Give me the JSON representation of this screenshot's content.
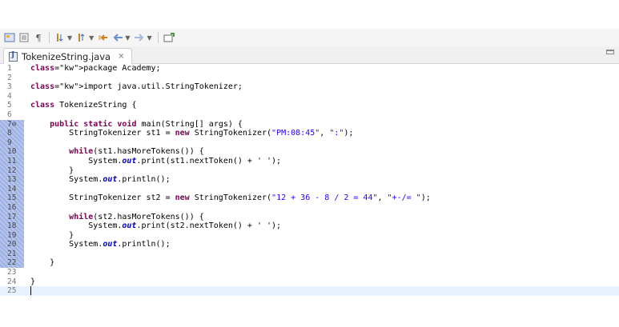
{
  "toolbar": {
    "icons": [
      "open-type-icon",
      "show-whitespace-icon",
      "pilcrow-icon",
      "next-annotation-icon",
      "prev-annotation-icon",
      "last-edit-icon",
      "back-icon",
      "forward-icon",
      "pin-editor-icon"
    ]
  },
  "tab": {
    "title": "TokenizeString.java",
    "close_glyph": "⨯"
  },
  "editor": {
    "lines": [
      {
        "n": "1",
        "code": "package Academy;"
      },
      {
        "n": "2",
        "code": ""
      },
      {
        "n": "3",
        "code": "import java.util.StringTokenizer;"
      },
      {
        "n": "4",
        "code": ""
      },
      {
        "n": "5",
        "code": "class TokenizeString {"
      },
      {
        "n": "6",
        "code": ""
      },
      {
        "n": "7⊖",
        "code": "    public static void main(String[] args) {"
      },
      {
        "n": "8",
        "code": "        StringTokenizer st1 = new StringTokenizer(\"PM:08:45\", \":\");"
      },
      {
        "n": "9",
        "code": ""
      },
      {
        "n": "10",
        "code": "        while(st1.hasMoreTokens()) {"
      },
      {
        "n": "11",
        "code": "            System.out.print(st1.nextToken() + ' ');"
      },
      {
        "n": "12",
        "code": "        }"
      },
      {
        "n": "13",
        "code": "        System.out.println();"
      },
      {
        "n": "14",
        "code": ""
      },
      {
        "n": "15",
        "code": "        StringTokenizer st2 = new StringTokenizer(\"12 + 36 - 8 / 2 = 44\", \"+-/= \");"
      },
      {
        "n": "16",
        "code": ""
      },
      {
        "n": "17",
        "code": "        while(st2.hasMoreTokens()) {"
      },
      {
        "n": "18",
        "code": "            System.out.print(st2.nextToken() + ' ');"
      },
      {
        "n": "19",
        "code": "        }"
      },
      {
        "n": "20",
        "code": "        System.out.println();"
      },
      {
        "n": "21",
        "code": ""
      },
      {
        "n": "22",
        "code": "    }"
      },
      {
        "n": "23",
        "code": ""
      },
      {
        "n": "24",
        "code": "}"
      },
      {
        "n": "25",
        "code": ""
      }
    ]
  },
  "colors": {
    "keyword": "#7f0055",
    "string": "#2a00ff",
    "static_field": "#0000c0",
    "current_line": "#e8f2fe",
    "ruler_highlight": "#a7b9e6"
  }
}
